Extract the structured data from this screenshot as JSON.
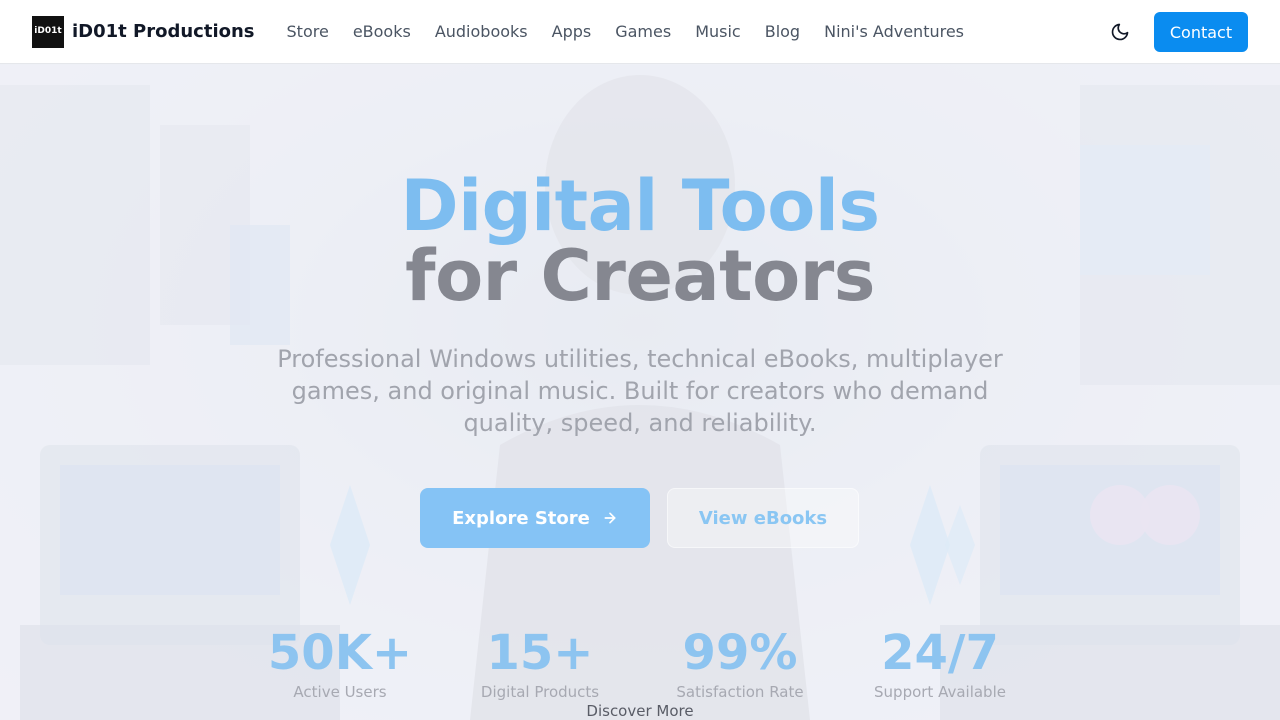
{
  "header": {
    "logo_text": "iD01t",
    "logo_subtext": "PRODUCTIONS",
    "brand": "iD01t Productions",
    "nav": [
      "Store",
      "eBooks",
      "Audiobooks",
      "Apps",
      "Games",
      "Music",
      "Blog",
      "Nini's Adventures"
    ],
    "theme_icon": "moon-icon",
    "contact_label": "Contact"
  },
  "hero": {
    "title_line1": "Digital Tools",
    "title_line2": "for Creators",
    "subtitle": "Professional Windows utilities, technical eBooks, multiplayer games, and original music. Built for creators who demand quality, speed, and reliability.",
    "primary_button": "Explore Store",
    "primary_button_icon": "arrow-right-icon",
    "secondary_button": "View eBooks",
    "stats": [
      {
        "value": "50K+",
        "label": "Active Users"
      },
      {
        "value": "15+",
        "label": "Digital Products"
      },
      {
        "value": "99%",
        "label": "Satisfaction Rate"
      },
      {
        "value": "24/7",
        "label": "Support Available"
      }
    ],
    "discover_label": "Discover More"
  },
  "colors": {
    "accent": "#0a8cf0",
    "title_gradient_start": "#7dbdf0",
    "title_dark": "#858790"
  }
}
